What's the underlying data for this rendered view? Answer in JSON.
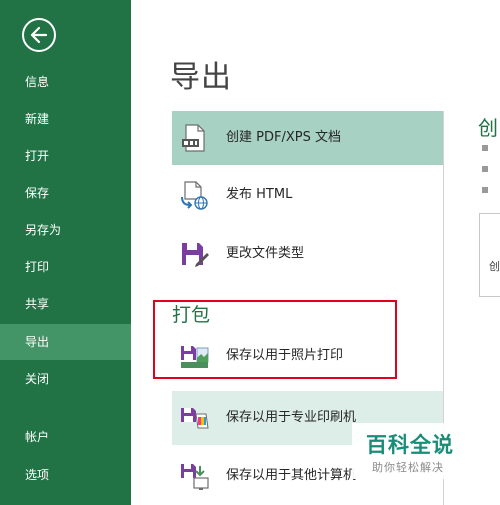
{
  "sidebar": {
    "items": [
      {
        "label": "信息"
      },
      {
        "label": "新建"
      },
      {
        "label": "打开"
      },
      {
        "label": "保存"
      },
      {
        "label": "另存为"
      },
      {
        "label": "打印"
      },
      {
        "label": "共享"
      },
      {
        "label": "导出",
        "active": true
      },
      {
        "label": "关闭"
      },
      {
        "label": "帐户"
      },
      {
        "label": "选项"
      }
    ]
  },
  "main": {
    "title": "导出",
    "export_options": [
      {
        "label": "创建 PDF/XPS 文档",
        "icon": "pdf-document-icon",
        "selected": true
      },
      {
        "label": "发布 HTML",
        "icon": "publish-html-icon"
      },
      {
        "label": "更改文件类型",
        "icon": "change-file-type-icon"
      }
    ],
    "package_section": {
      "title": "打包",
      "options": [
        {
          "label": "保存以用于照片打印",
          "icon": "photo-print-icon"
        },
        {
          "label": "保存以用于专业印刷机",
          "icon": "press-print-icon"
        },
        {
          "label": "保存以用于其他计算机",
          "icon": "other-computer-icon"
        }
      ]
    }
  },
  "right_panel": {
    "heading": "创",
    "card_text": "创"
  },
  "watermark": {
    "title": "百科全说",
    "subtitle": "助你轻松解决"
  },
  "colors": {
    "sidebar": "#217346",
    "sidebar_active": "#439467",
    "selected_item": "#a7d1c2",
    "highlight_box": "#e3001b",
    "accent_text": "#217346"
  }
}
